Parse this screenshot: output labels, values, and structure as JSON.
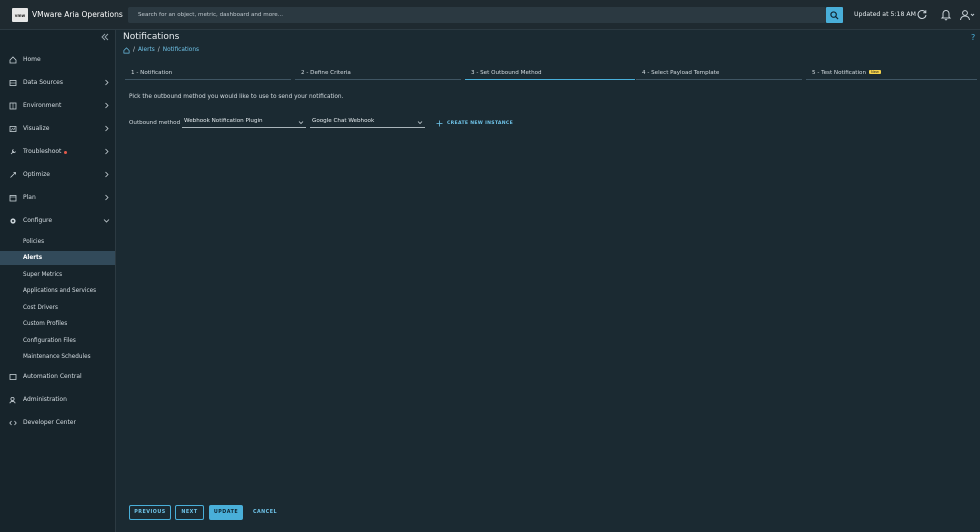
{
  "app": {
    "logo": "vmw",
    "title": "VMware Aria Operations"
  },
  "search": {
    "placeholder": "Search for an object, metric, dashboard and more..."
  },
  "header": {
    "updated": "Updated at 5:18 AM"
  },
  "icons": {
    "search": "search-icon",
    "refresh": "refresh-icon",
    "bell": "bell-icon",
    "user": "user-icon",
    "collapse": "double-chevron-left-icon",
    "home": "home-icon",
    "plus": "plus-icon"
  },
  "colors": {
    "accent": "#49afd9",
    "link": "#6fc3e8",
    "background": "#1b2a32",
    "sidebar": "#17242b",
    "badge": "#f5d24a",
    "alert_dot": "#e35a4b"
  },
  "sidebar": {
    "items": [
      {
        "label": "Home"
      },
      {
        "label": "Data Sources"
      },
      {
        "label": "Environment"
      },
      {
        "label": "Visualize"
      },
      {
        "label": "Troubleshoot"
      },
      {
        "label": "Optimize"
      },
      {
        "label": "Plan"
      },
      {
        "label": "Configure"
      }
    ],
    "configure_items": [
      {
        "label": "Policies"
      },
      {
        "label": "Alerts"
      },
      {
        "label": "Super Metrics"
      },
      {
        "label": "Applications and Services"
      },
      {
        "label": "Cost Drivers"
      },
      {
        "label": "Custom Profiles"
      },
      {
        "label": "Configuration Files"
      },
      {
        "label": "Maintenance Schedules"
      }
    ],
    "bottom_items": [
      {
        "label": "Automation Central"
      },
      {
        "label": "Administration"
      },
      {
        "label": "Developer Center"
      }
    ]
  },
  "page": {
    "title": "Notifications",
    "breadcrumb": {
      "sep1": "/",
      "item1": "Alerts",
      "sep2": "/",
      "item2": "Notifications"
    },
    "help": "?"
  },
  "steps": [
    {
      "label": "1 - Notification"
    },
    {
      "label": "2 - Define Criteria"
    },
    {
      "label": "3 - Set Outbound Method"
    },
    {
      "label": "4 - Select Payload Template"
    },
    {
      "label": "5 - Test Notification",
      "badge": "New"
    }
  ],
  "form": {
    "instruction": "Pick the outbound method you would like to use to send your notification.",
    "method_label": "Outbound method",
    "plugin_value": "Webhook Notification Plugin",
    "instance_value": "Google Chat Webhook",
    "create_label": "CREATE NEW INSTANCE"
  },
  "footer": {
    "previous": "PREVIOUS",
    "next": "NEXT",
    "update": "UPDATE",
    "cancel": "CANCEL"
  }
}
